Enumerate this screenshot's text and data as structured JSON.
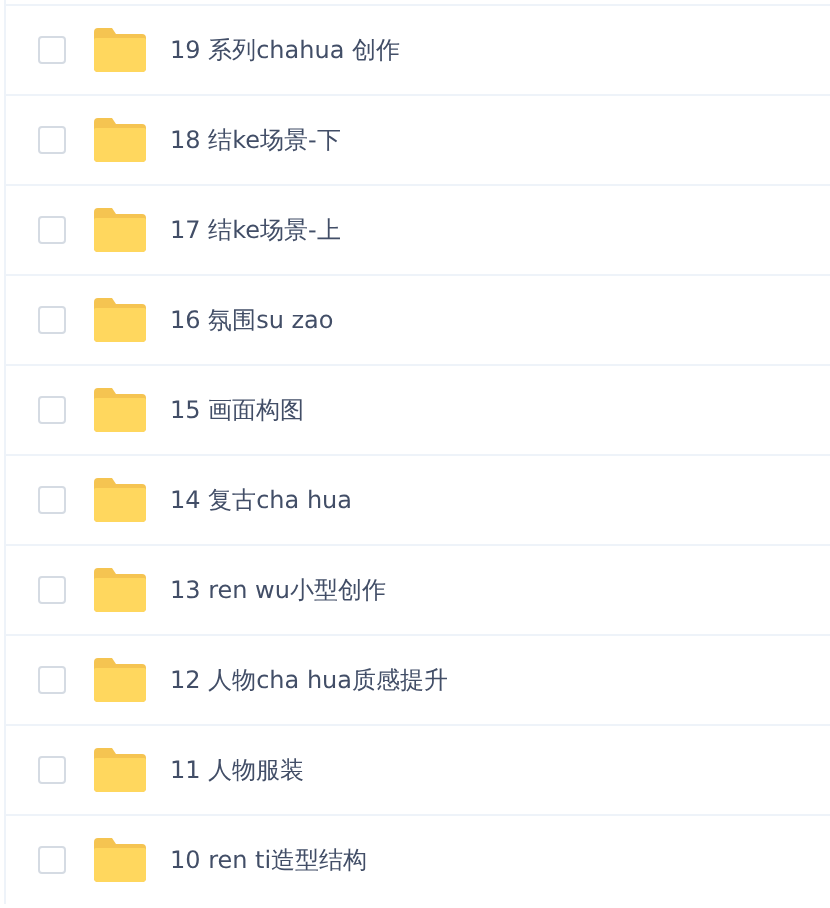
{
  "files": [
    {
      "name": "19 系列chahua 创作",
      "checked": false
    },
    {
      "name": "18 结ke场景-下",
      "checked": false
    },
    {
      "name": "17 结ke场景-上",
      "checked": false
    },
    {
      "name": "16 氛围su zao",
      "checked": false
    },
    {
      "name": "15 画面构图",
      "checked": false
    },
    {
      "name": "14 复古cha hua",
      "checked": false
    },
    {
      "name": "13 ren wu小型创作",
      "checked": false
    },
    {
      "name": "12 人物cha hua质感提升",
      "checked": false
    },
    {
      "name": "11 人物服装",
      "checked": false
    },
    {
      "name": "10 ren ti造型结构",
      "checked": false
    }
  ]
}
